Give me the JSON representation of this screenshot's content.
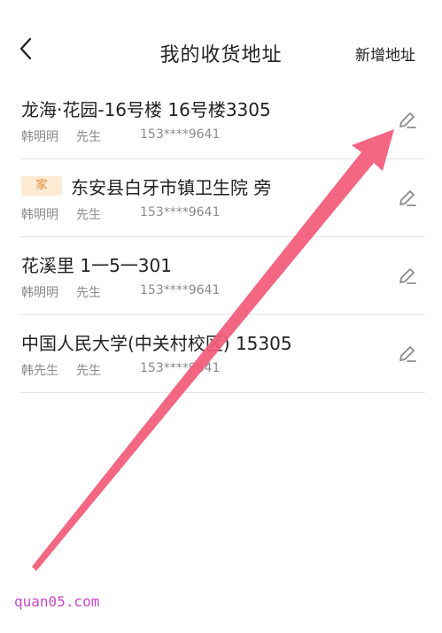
{
  "header": {
    "back_icon": "chevron-left-icon",
    "title": "我的收货地址",
    "add_label": "新增地址"
  },
  "addresses": [
    {
      "tag": "",
      "address": "龙海·花园-16号楼 16号楼3305",
      "name": "韩明明",
      "title": "先生",
      "phone": "153****9641",
      "edit_icon": "pencil-icon"
    },
    {
      "tag": "家",
      "address": "东安县白牙市镇卫生院 旁",
      "name": "韩明明",
      "title": "先生",
      "phone": "153****9641",
      "edit_icon": "pencil-icon"
    },
    {
      "tag": "",
      "address": "花溪里 1一5一301",
      "name": "韩明明",
      "title": "先生",
      "phone": "153****9641",
      "edit_icon": "pencil-icon"
    },
    {
      "tag": "",
      "address": "中国人民大学(中关村校区) 15305",
      "name": "韩先生",
      "title": "先生",
      "phone": "153****9641",
      "edit_icon": "pencil-icon"
    }
  ],
  "colors": {
    "tag_bg": "#fdebd3",
    "tag_text": "#e88a2e",
    "annotation_arrow": "#f25a78",
    "watermark": "#c848c8"
  },
  "watermark": "quan05.com"
}
